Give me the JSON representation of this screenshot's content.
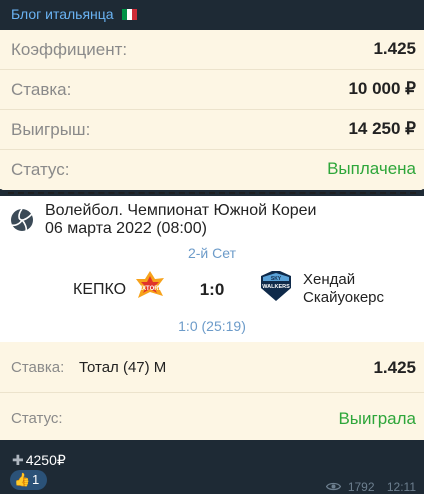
{
  "header": {
    "channel": "Блог итальянца",
    "flag_colors": [
      "#009246",
      "#ffffff",
      "#ce2b37"
    ]
  },
  "bet_summary": [
    {
      "label": "Коэффициент:",
      "value": "1.425"
    },
    {
      "label": "Ставка:",
      "value": "10 000 ₽"
    },
    {
      "label": "Выигрыш:",
      "value": "14 250 ₽"
    },
    {
      "label": "Статус:",
      "value": "Выплачена"
    }
  ],
  "match": {
    "icon": "volleyball-icon",
    "league": "Волейбол. Чемпионат Южной Кореи",
    "date": "06 марта 2022 (08:00)",
    "set": "2-й Сет",
    "team1": "КЕПКО",
    "team1_logo_text": "VIXTORM",
    "score": "1:0",
    "team2_line1": "Хендай",
    "team2_line2": "Скайуокерс",
    "team2_logo_text_1": "SKY",
    "team2_logo_text_2": "WALKERS",
    "set_score": "1:0 (25:19)"
  },
  "bet_details": {
    "bet_label": "Ставка:",
    "bet_value": "Тотал (47) М",
    "odds": "1.425",
    "status_label": "Статус:",
    "status_value": "Выиграла"
  },
  "footer": {
    "profit": "4250₽",
    "plus_icon": "plus-icon",
    "reaction_emoji": "👍",
    "reaction_count": "1",
    "views": "1792",
    "time": "12:11"
  },
  "colors": {
    "accent_green": "#2ea63a",
    "link_blue": "#6ab3f3",
    "card_bg": "#fdf6e4",
    "dark_bg": "#1e2a35"
  }
}
